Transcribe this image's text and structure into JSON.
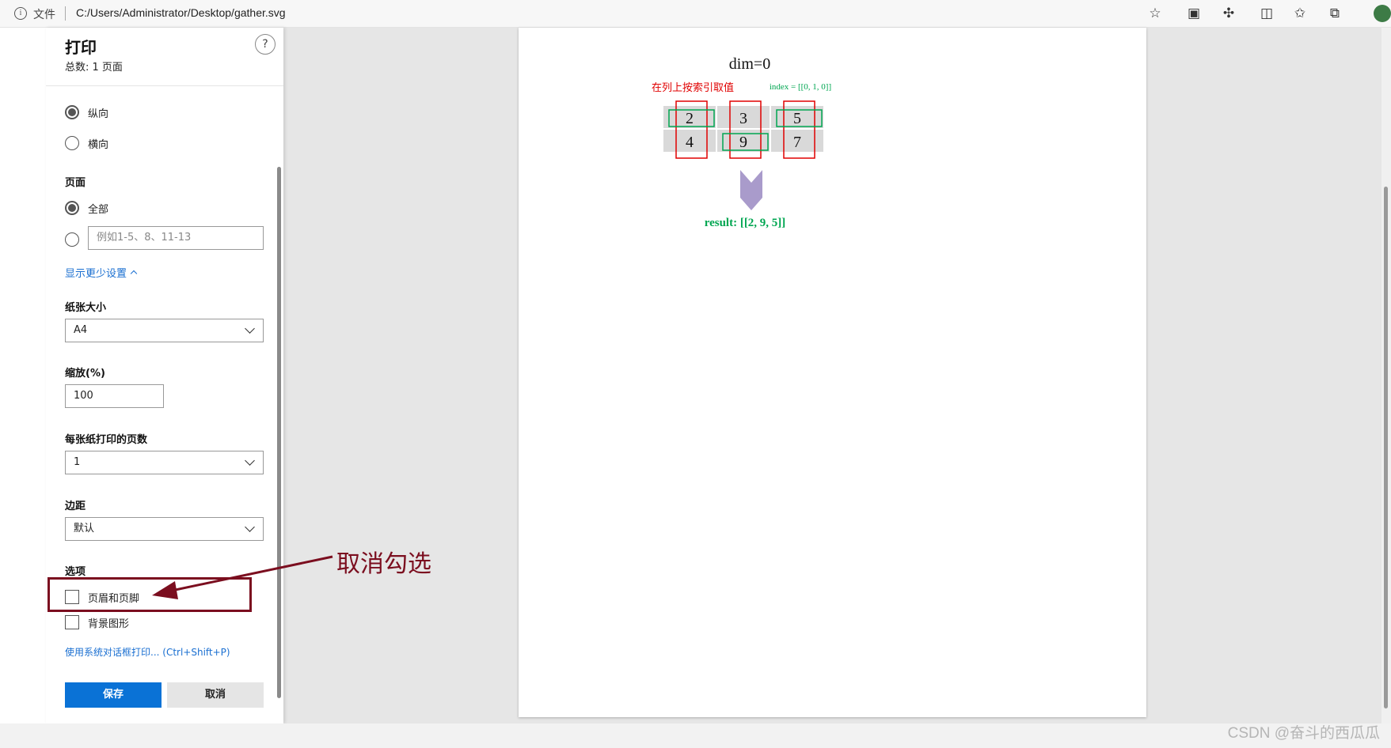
{
  "browser": {
    "file_label": "文件",
    "url": "C:/Users/Administrator/Desktop/gather.svg"
  },
  "print_panel": {
    "title": "打印",
    "subtitle": "总数: 1 页面",
    "help": "?",
    "orientation": {
      "portrait": "纵向",
      "landscape": "横向",
      "selected": "portrait"
    },
    "pages": {
      "heading": "页面",
      "all": "全部",
      "custom_placeholder": "例如1-5、8、11-13"
    },
    "more_settings": "显示更少设置",
    "paper_size": {
      "heading": "纸张大小",
      "value": "A4"
    },
    "scale": {
      "heading": "缩放(%)",
      "value": "100"
    },
    "pages_per_sheet": {
      "heading": "每张纸打印的页数",
      "value": "1"
    },
    "margins": {
      "heading": "边距",
      "value": "默认"
    },
    "options": {
      "heading": "选项",
      "headers_footers": "页眉和页脚",
      "background_graphics": "背景图形"
    },
    "system_dialog": "使用系统对话框打印... (Ctrl+Shift+P)",
    "save": "保存",
    "cancel": "取消"
  },
  "preview": {
    "title": "dim=0",
    "caption": "在列上按索引取值",
    "index_label": "index = [[0, 1, 0]]",
    "matrix": [
      [
        "2",
        "3",
        "5"
      ],
      [
        "4",
        "9",
        "7"
      ]
    ],
    "result": "result: [[2, 9, 5]]",
    "colors": {
      "red": "#e00000",
      "green": "#00a651",
      "arrow": "#a99bcb",
      "cell": "#d9d9d9"
    }
  },
  "annotation": {
    "text": "取消勾选",
    "color": "#7b0e1f"
  },
  "watermark": "CSDN @奋斗的西瓜瓜"
}
